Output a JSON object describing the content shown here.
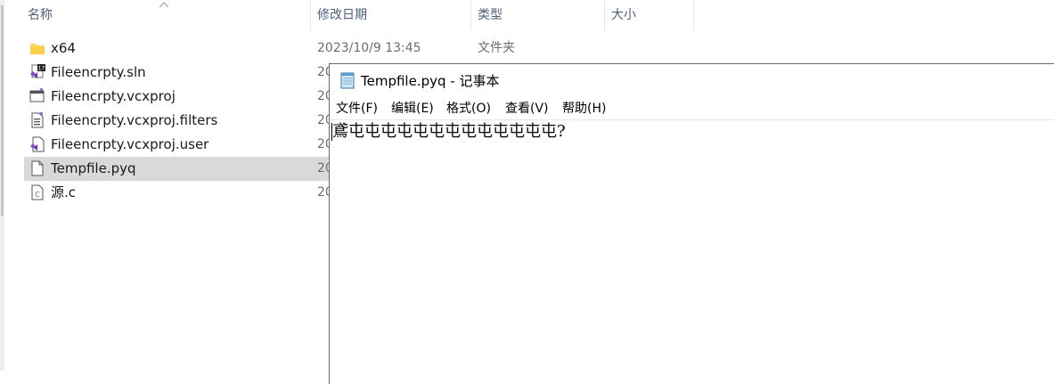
{
  "explorer": {
    "columns": {
      "name": "名称",
      "modified": "修改日期",
      "type": "类型",
      "size": "大小"
    },
    "files": [
      {
        "name": "x64",
        "date": "2023/10/9 13:45",
        "type": "文件夹",
        "icon": "folder-icon"
      },
      {
        "name": "Fileencrpty.sln",
        "date": "20",
        "type": "",
        "icon": "vs-solution-icon"
      },
      {
        "name": "Fileencrpty.vcxproj",
        "date": "20",
        "type": "",
        "icon": "vcxproj-icon"
      },
      {
        "name": "Fileencrpty.vcxproj.filters",
        "date": "20",
        "type": "",
        "icon": "filters-file-icon"
      },
      {
        "name": "Fileencrpty.vcxproj.user",
        "date": "20",
        "type": "",
        "icon": "vs-user-file-icon"
      },
      {
        "name": "Tempfile.pyq",
        "date": "20",
        "type": "",
        "icon": "blank-file-icon",
        "selected": true
      },
      {
        "name": "源.c",
        "date": "20",
        "type": "",
        "icon": "c-source-file-icon"
      }
    ]
  },
  "notepad": {
    "title": "Tempfile.pyq - 记事本",
    "menu": [
      "文件(F)",
      "编辑(E)",
      "格式(O)",
      "查看(V)",
      "帮助(H)"
    ],
    "content": "鳶屯屯屯屯屯屯屯屯屯屯屯屯屯?",
    "colors": {
      "selection": "#d9d9d9",
      "header_text": "#4c607a",
      "secondary_text": "#6d6d6d"
    }
  }
}
